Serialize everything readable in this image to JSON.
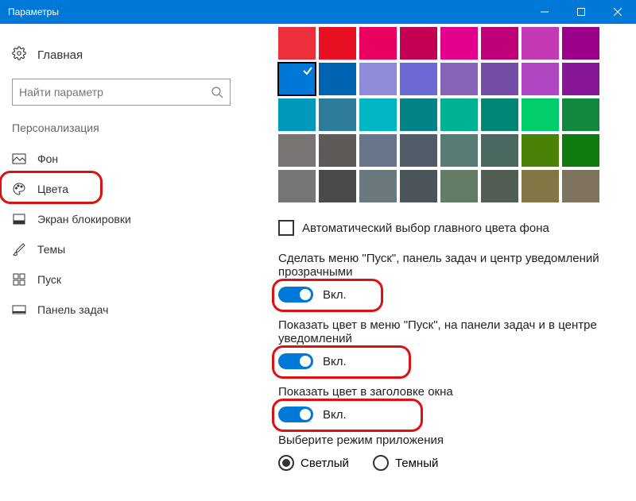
{
  "titlebar": {
    "title": "Параметры"
  },
  "sidebar": {
    "home": "Главная",
    "search_placeholder": "Найти параметр",
    "section": "Персонализация",
    "items": [
      {
        "label": "Фон"
      },
      {
        "label": "Цвета"
      },
      {
        "label": "Экран блокировки"
      },
      {
        "label": "Темы"
      },
      {
        "label": "Пуск"
      },
      {
        "label": "Панель задач"
      }
    ]
  },
  "palette": {
    "colors": [
      "#ed2f3b",
      "#e81123",
      "#ea005e",
      "#c30052",
      "#e3008c",
      "#bf0077",
      "#c239b3",
      "#9a0089",
      "#0078d7",
      "#0063b1",
      "#8e8cd8",
      "#6b69d6",
      "#8764b8",
      "#744da9",
      "#b146c2",
      "#881798",
      "#0099bc",
      "#2d7d9a",
      "#00b7c3",
      "#038387",
      "#00b294",
      "#018574",
      "#00cc6a",
      "#10893e",
      "#7a7574",
      "#5d5a58",
      "#68768a",
      "#515c6b",
      "#567c73",
      "#486860",
      "#498205",
      "#107c10",
      "#767676",
      "#4c4a48",
      "#69797e",
      "#4a5459",
      "#647c64",
      "#525e54",
      "#847545",
      "#7e735f"
    ],
    "selected_index": 8
  },
  "auto_color": {
    "label": "Автоматический выбор главного цвета фона"
  },
  "toggles": [
    {
      "desc": "Сделать меню \"Пуск\", панель задач и центр уведомлений прозрачными",
      "state": "Вкл."
    },
    {
      "desc": "Показать цвет в меню \"Пуск\", на панели задач и в центре уведомлений",
      "state": "Вкл."
    },
    {
      "desc": "Показать цвет в заголовке окна",
      "state": "Вкл."
    }
  ],
  "mode": {
    "label": "Выберите режим приложения",
    "options": [
      "Светлый",
      "Темный"
    ]
  }
}
